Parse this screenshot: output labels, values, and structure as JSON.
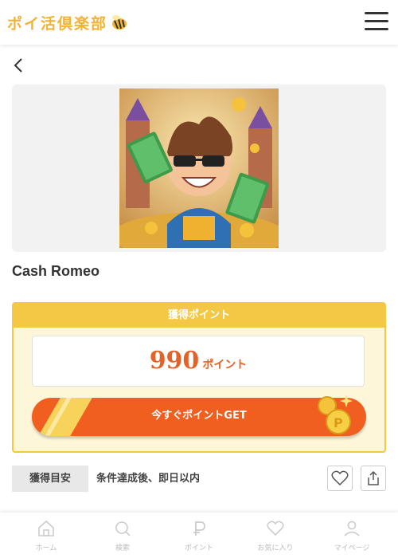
{
  "header": {
    "logo_text": "ポイ活倶楽部"
  },
  "offer": {
    "title": "Cash Romeo"
  },
  "points": {
    "heading": "獲得ポイント",
    "value": "990",
    "unit": "ポイント",
    "cta_label": "今すぐポイントGET"
  },
  "rule": {
    "tag": "獲得目安",
    "text": "条件達成後、即日以内"
  },
  "bottom_nav": [
    {
      "label": "ホーム",
      "icon": "home-icon"
    },
    {
      "label": "検索",
      "icon": "search-icon"
    },
    {
      "label": "ポイント",
      "icon": "point-icon"
    },
    {
      "label": "お気に入り",
      "icon": "heart-icon"
    },
    {
      "label": "マイページ",
      "icon": "user-icon"
    }
  ],
  "colors": {
    "accent": "#f05e20",
    "gold": "#f4c845",
    "points_text": "#e3622a"
  }
}
